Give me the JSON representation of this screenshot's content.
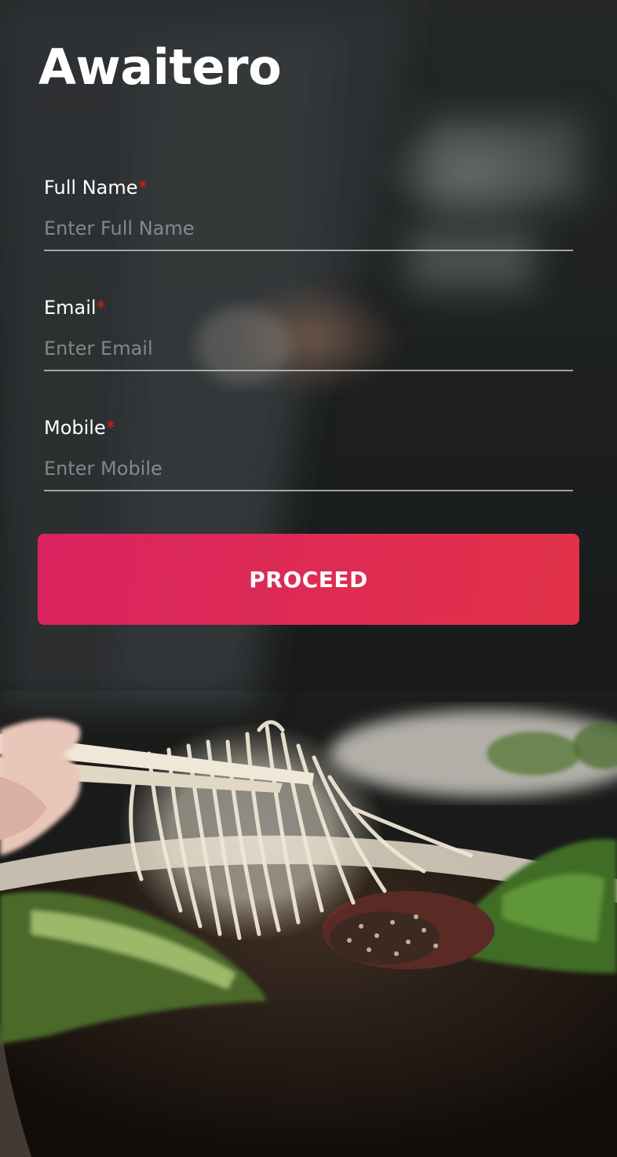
{
  "app": {
    "title": "Awaitero"
  },
  "form": {
    "required_marker": "*",
    "fields": [
      {
        "label": "Full Name",
        "placeholder": "Enter Full Name",
        "value": ""
      },
      {
        "label": "Email",
        "placeholder": "Enter Email",
        "value": ""
      },
      {
        "label": "Mobile",
        "placeholder": "Enter Mobile",
        "value": ""
      }
    ],
    "submit_label": "PROCEED"
  },
  "colors": {
    "accent_start": "#d92460",
    "accent_end": "#e13248",
    "required_marker": "#e21a1a",
    "background_dark": "#1a1c1c"
  },
  "background": {
    "subject": "chef-with-noodle-bowl-photo"
  }
}
